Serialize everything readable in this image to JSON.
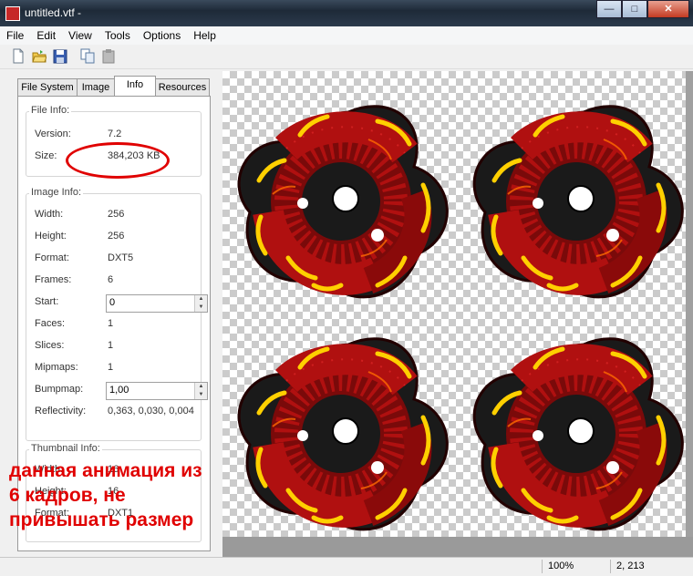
{
  "window": {
    "title": "untitled.vtf -",
    "buttons": {
      "minimize": "—",
      "maximize": "□",
      "close": "✕"
    }
  },
  "menu": [
    "File",
    "Edit",
    "View",
    "Tools",
    "Options",
    "Help"
  ],
  "toolbar": [
    "new-icon",
    "open-icon",
    "save-icon",
    "copy-icon",
    "paste-icon"
  ],
  "tabs": [
    "File System",
    "Image",
    "Info",
    "Resources"
  ],
  "active_tab": "Info",
  "file_info": {
    "label": "File Info:",
    "version_label": "Version:",
    "version": "7.2",
    "size_label": "Size:",
    "size": "384,203 KB"
  },
  "image_info": {
    "label": "Image Info:",
    "width_label": "Width:",
    "width": "256",
    "height_label": "Height:",
    "height": "256",
    "format_label": "Format:",
    "format": "DXT5",
    "frames_label": "Frames:",
    "frames": "6",
    "start_label": "Start:",
    "start": "0",
    "faces_label": "Faces:",
    "faces": "1",
    "slices_label": "Slices:",
    "slices": "1",
    "mipmaps_label": "Mipmaps:",
    "mipmaps": "1",
    "bumpmap_label": "Bumpmap:",
    "bumpmap": "1,00",
    "reflectivity_label": "Reflectivity:",
    "reflectivity": "0,363, 0,030, 0,004"
  },
  "thumbnail_info": {
    "label": "Thumbnail Info:",
    "width_label": "Width:",
    "width": "16",
    "height_label": "Height:",
    "height": "16",
    "format_label": "Format:",
    "format": "DXT1"
  },
  "annotation": [
    "данная анимация из",
    "6 кадров, не",
    "привышать размер"
  ],
  "status": {
    "zoom": "100%",
    "coords": "2, 213"
  },
  "colors": {
    "annotation": "#e00000",
    "knot_body": "#1a1a1a",
    "knot_ring": "#b01010",
    "glow": "#ffd000"
  }
}
